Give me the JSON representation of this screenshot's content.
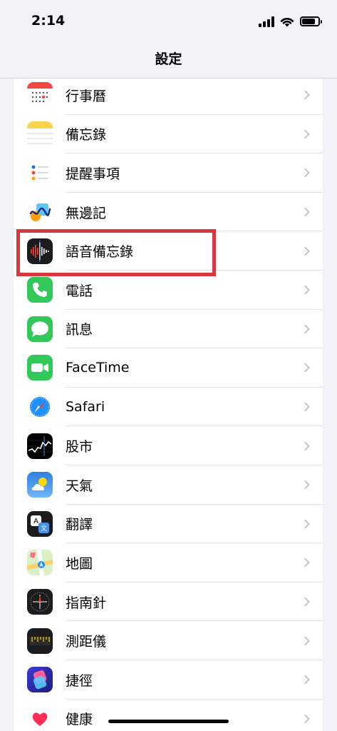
{
  "status": {
    "time": "2:14",
    "battery_level": 0.8
  },
  "nav": {
    "title": "設定"
  },
  "rows": [
    {
      "label": "行事曆",
      "icon": "calendar-icon"
    },
    {
      "label": "備忘錄",
      "icon": "notes-icon"
    },
    {
      "label": "提醒事項",
      "icon": "reminders-icon"
    },
    {
      "label": "無邊記",
      "icon": "freeform-icon"
    },
    {
      "label": "語音備忘錄",
      "icon": "voice-memos-icon"
    },
    {
      "label": "電話",
      "icon": "phone-icon"
    },
    {
      "label": "訊息",
      "icon": "messages-icon"
    },
    {
      "label": "FaceTime",
      "icon": "facetime-icon"
    },
    {
      "label": "Safari",
      "icon": "safari-icon"
    },
    {
      "label": "股市",
      "icon": "stocks-icon"
    },
    {
      "label": "天氣",
      "icon": "weather-icon"
    },
    {
      "label": "翻譯",
      "icon": "translate-icon"
    },
    {
      "label": "地圖",
      "icon": "maps-icon"
    },
    {
      "label": "指南針",
      "icon": "compass-icon"
    },
    {
      "label": "測距儀",
      "icon": "measure-icon"
    },
    {
      "label": "捷徑",
      "icon": "shortcuts-icon"
    },
    {
      "label": "健康",
      "icon": "health-icon"
    }
  ],
  "highlighted_item": "語音備忘錄"
}
